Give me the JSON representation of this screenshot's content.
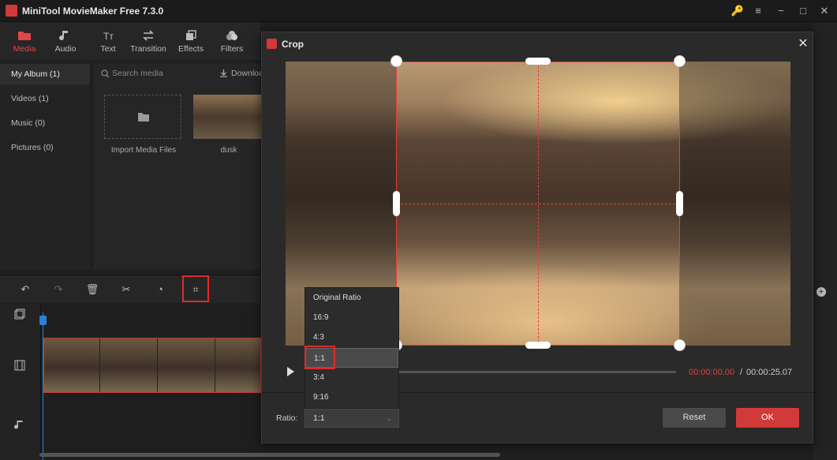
{
  "app": {
    "title": "MiniTool MovieMaker Free 7.3.0"
  },
  "window_controls": {
    "key": "🔑",
    "menu": "≡",
    "minimize": "−",
    "maximize": "□",
    "close": "✕"
  },
  "toolbar": {
    "items": [
      {
        "label": "Media"
      },
      {
        "label": "Audio"
      },
      {
        "label": "Text"
      },
      {
        "label": "Transition"
      },
      {
        "label": "Effects"
      },
      {
        "label": "Filters"
      }
    ]
  },
  "left_nav": {
    "items": [
      {
        "label": "My Album (1)"
      },
      {
        "label": "Videos (1)"
      },
      {
        "label": "Music (0)"
      },
      {
        "label": "Pictures (0)"
      }
    ]
  },
  "media": {
    "search_placeholder": "Search media",
    "download_label": "Download",
    "import_label": "Import Media Files",
    "clip_label": "dusk"
  },
  "crop_dialog": {
    "title": "Crop",
    "time_current": "00:00:00.00",
    "time_separator": "/",
    "time_total": "00:00:25.07",
    "ratio_label": "Ratio:",
    "ratio_selected": "1:1",
    "ratio_options": [
      {
        "label": "Original Ratio"
      },
      {
        "label": "16:9"
      },
      {
        "label": "4:3"
      },
      {
        "label": "1:1"
      },
      {
        "label": "3:4"
      },
      {
        "label": "9:16"
      }
    ],
    "reset_label": "Reset",
    "ok_label": "OK"
  },
  "colors": {
    "accent": "#d23a3a",
    "highlight": "#e02a2a",
    "background": "#1f1f1f"
  }
}
